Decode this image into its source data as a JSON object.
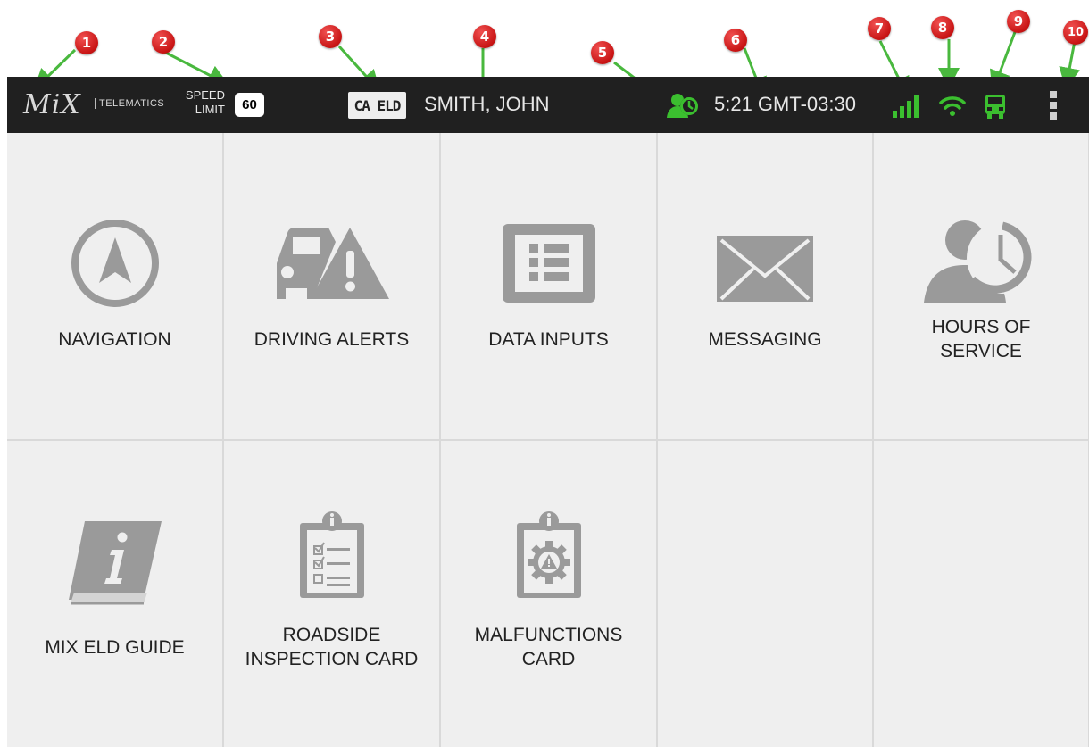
{
  "callouts": [
    "1",
    "2",
    "3",
    "4",
    "5",
    "6",
    "7",
    "8",
    "9",
    "10"
  ],
  "topbar": {
    "logo": "MiX",
    "logo_sub": "TELEMATICS",
    "speed_label_line1": "SPEED",
    "speed_label_line2": "LIMIT",
    "speed_limit": "60",
    "eld_badge": "CA ELD",
    "driver_name": "SMITH, JOHN",
    "clock": "5:21 GMT-03:30",
    "icons": {
      "hos": "hours-of-service-icon",
      "signal": "signal-strength-icon",
      "wifi": "wifi-icon",
      "vehicle": "truck-icon",
      "menu": "overflow-menu-icon"
    },
    "status_color": "#3bbf2f",
    "bar_color": "#202020"
  },
  "tiles": [
    {
      "label_lines": [
        "NAVIGATION"
      ],
      "icon": "navigation-compass-icon"
    },
    {
      "label_lines": [
        "DRIVING ALERTS"
      ],
      "icon": "car-warning-icon"
    },
    {
      "label_lines": [
        "DATA INPUTS"
      ],
      "icon": "form-list-icon"
    },
    {
      "label_lines": [
        "MESSAGING"
      ],
      "icon": "envelope-icon"
    },
    {
      "label_lines": [
        "HOURS OF",
        "SERVICE"
      ],
      "icon": "person-clock-icon"
    },
    {
      "label_lines": [
        "MIX ELD GUIDE"
      ],
      "icon": "info-book-icon"
    },
    {
      "label_lines": [
        "ROADSIDE",
        "INSPECTION CARD"
      ],
      "icon": "clipboard-checklist-icon"
    },
    {
      "label_lines": [
        "MALFUNCTIONS",
        "CARD"
      ],
      "icon": "clipboard-gear-warning-icon"
    },
    {
      "label_lines": [],
      "icon": ""
    },
    {
      "label_lines": [],
      "icon": ""
    }
  ],
  "icon_color": "#9a9a9a"
}
